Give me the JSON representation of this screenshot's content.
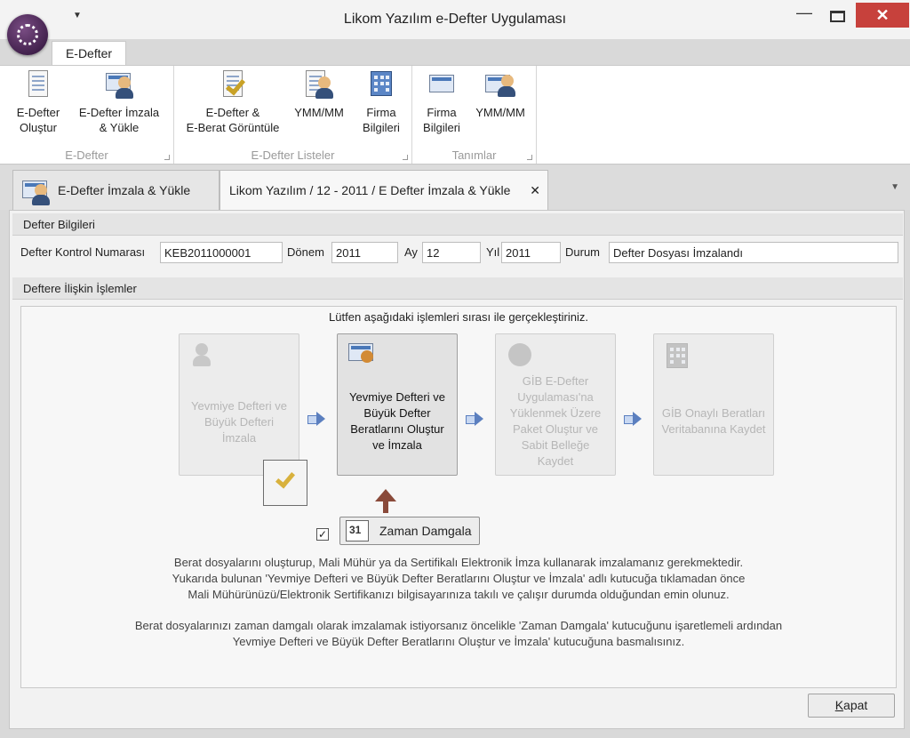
{
  "window": {
    "title": "Likom Yazılım e-Defter Uygulaması",
    "minimize": "—",
    "close": "✕"
  },
  "ribbon": {
    "active_tab": "E-Defter",
    "groups": [
      {
        "label": "E-Defter",
        "buttons": [
          "E-Defter\nOluştur",
          "E-Defter İmzala\n& Yükle"
        ]
      },
      {
        "label": "E-Defter Listeler",
        "buttons": [
          "E-Defter &\nE-Berat Görüntüle",
          "YMM/MM",
          "Firma\nBilgileri"
        ]
      },
      {
        "label": "Tanımlar",
        "buttons": [
          "Firma\nBilgileri",
          "YMM/MM"
        ]
      }
    ]
  },
  "doc_tabs": [
    {
      "label": "E-Defter İmzala & Yükle"
    },
    {
      "label": "Likom Yazılım / 12 - 2011 / E Defter İmzala & Yükle",
      "close": "✕"
    }
  ],
  "defter_bilgileri": {
    "header": "Defter Bilgileri",
    "kontrol_label": "Defter Kontrol Numarası",
    "kontrol_value": "KEB2011000001",
    "donem_label": "Dönem",
    "donem_value": "2011",
    "ay_label": "Ay",
    "ay_value": "12",
    "yil_label": "Yıl",
    "yil_value": "2011",
    "durum_label": "Durum",
    "durum_value": "Defter Dosyası İmzalandı"
  },
  "islemler": {
    "header": "Deftere İlişkin İşlemler",
    "instruction": "Lütfen aşağıdaki işlemleri sırası ile gerçekleştiriniz.",
    "steps": [
      "Yevmiye Defteri ve\nBüyük Defteri\nİmzala",
      "Yevmiye Defteri ve\nBüyük Defter\nBeratlarını Oluştur\nve İmzala",
      "GİB E-Defter\nUygulaması'na\nYüklenmek Üzere\nPaket Oluştur ve\nSabit Belleğe\nKaydet",
      "GİB Onaylı Beratları\nVeritabanına Kaydet"
    ],
    "checkbox_mark": "✓",
    "zaman_button": "Zaman Damgala",
    "info1": [
      "Berat dosyalarını oluşturup, Mali Mühür ya da Sertifikalı Elektronik İmza kullanarak imzalamanız gerekmektedir.",
      "Yukarıda bulunan 'Yevmiye Defteri ve Büyük Defter Beratlarını Oluştur ve İmzala' adlı kutucuğa tıklamadan önce",
      "Mali Mühürünüzü/Elektronik Sertifikanızı bilgisayarınıza takılı ve çalışır durumda olduğundan emin olunuz."
    ],
    "info2": [
      "Berat dosyalarınızı zaman damgalı olarak imzalamak istiyorsanız öncelikle 'Zaman Damgala' kutucuğunu işaretlemeli ardından",
      "Yevmiye Defteri ve Büyük Defter Beratlarını Oluştur ve İmzala' kutucuğuna basmalısınız."
    ]
  },
  "kapat": {
    "first": "K",
    "rest": "apat"
  }
}
